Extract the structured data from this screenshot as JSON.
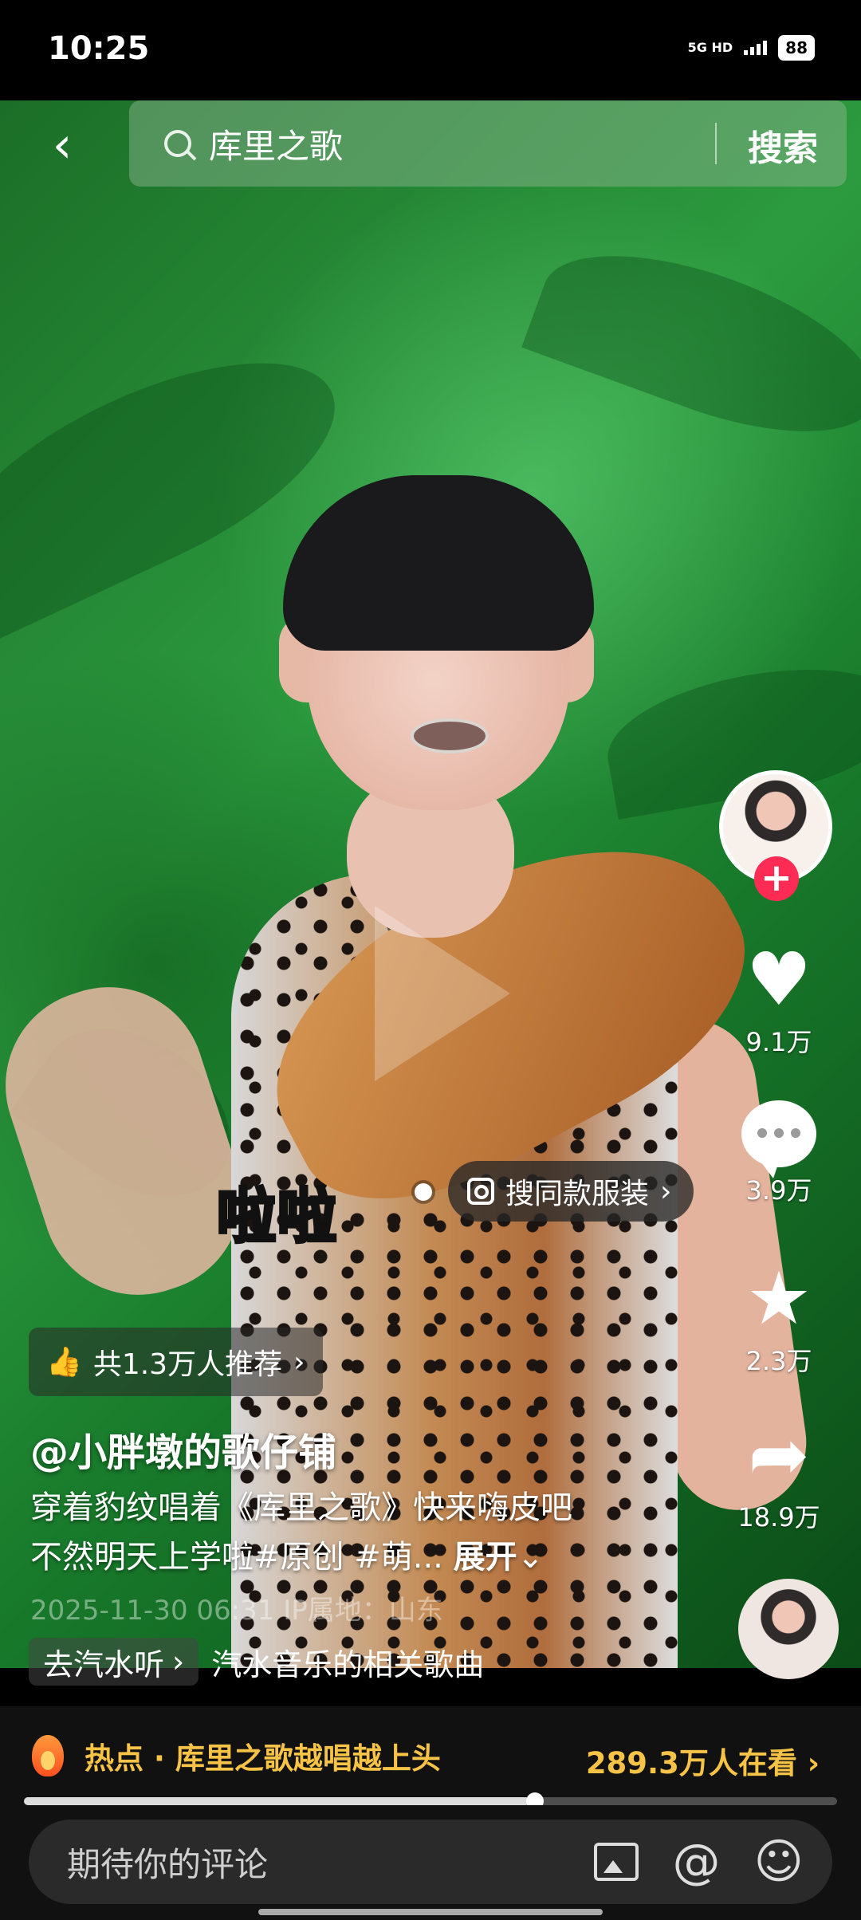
{
  "status_bar": {
    "time": "10:25",
    "network": "5G HD",
    "battery": "88"
  },
  "search": {
    "query": "库里之歌",
    "button": "搜索"
  },
  "video": {
    "caption": "啦啦",
    "shop_tag": "搜同款服装"
  },
  "sidebar": {
    "like_count": "9.1万",
    "comment_count": "3.9万",
    "favorite_count": "2.3万",
    "share_count": "18.9万"
  },
  "recommend": {
    "label": "共1.3万人推荐"
  },
  "author": {
    "name": "@小胖墩的歌仔铺"
  },
  "description": {
    "line1": "穿着豹纹唱着《库里之歌》快来嗨皮吧",
    "line2": "不然明天上学啦#原创 #萌...",
    "expand": "展开"
  },
  "meta": {
    "date": "2025-11-30 06:31",
    "location": "IP属地：山东"
  },
  "music": {
    "chip": "去汽水听",
    "title": "汽水音乐的相关歌曲"
  },
  "hot_bar": {
    "label": "热点 · 库里之歌越唱越上头",
    "viewers": "289.3万人在看"
  },
  "progress": 0.62,
  "comment_input": {
    "placeholder": "期待你的评论"
  },
  "colors": {
    "accent": "#fe2c55",
    "hot": "#f6c347",
    "video_bg": "#2c9b3f"
  }
}
